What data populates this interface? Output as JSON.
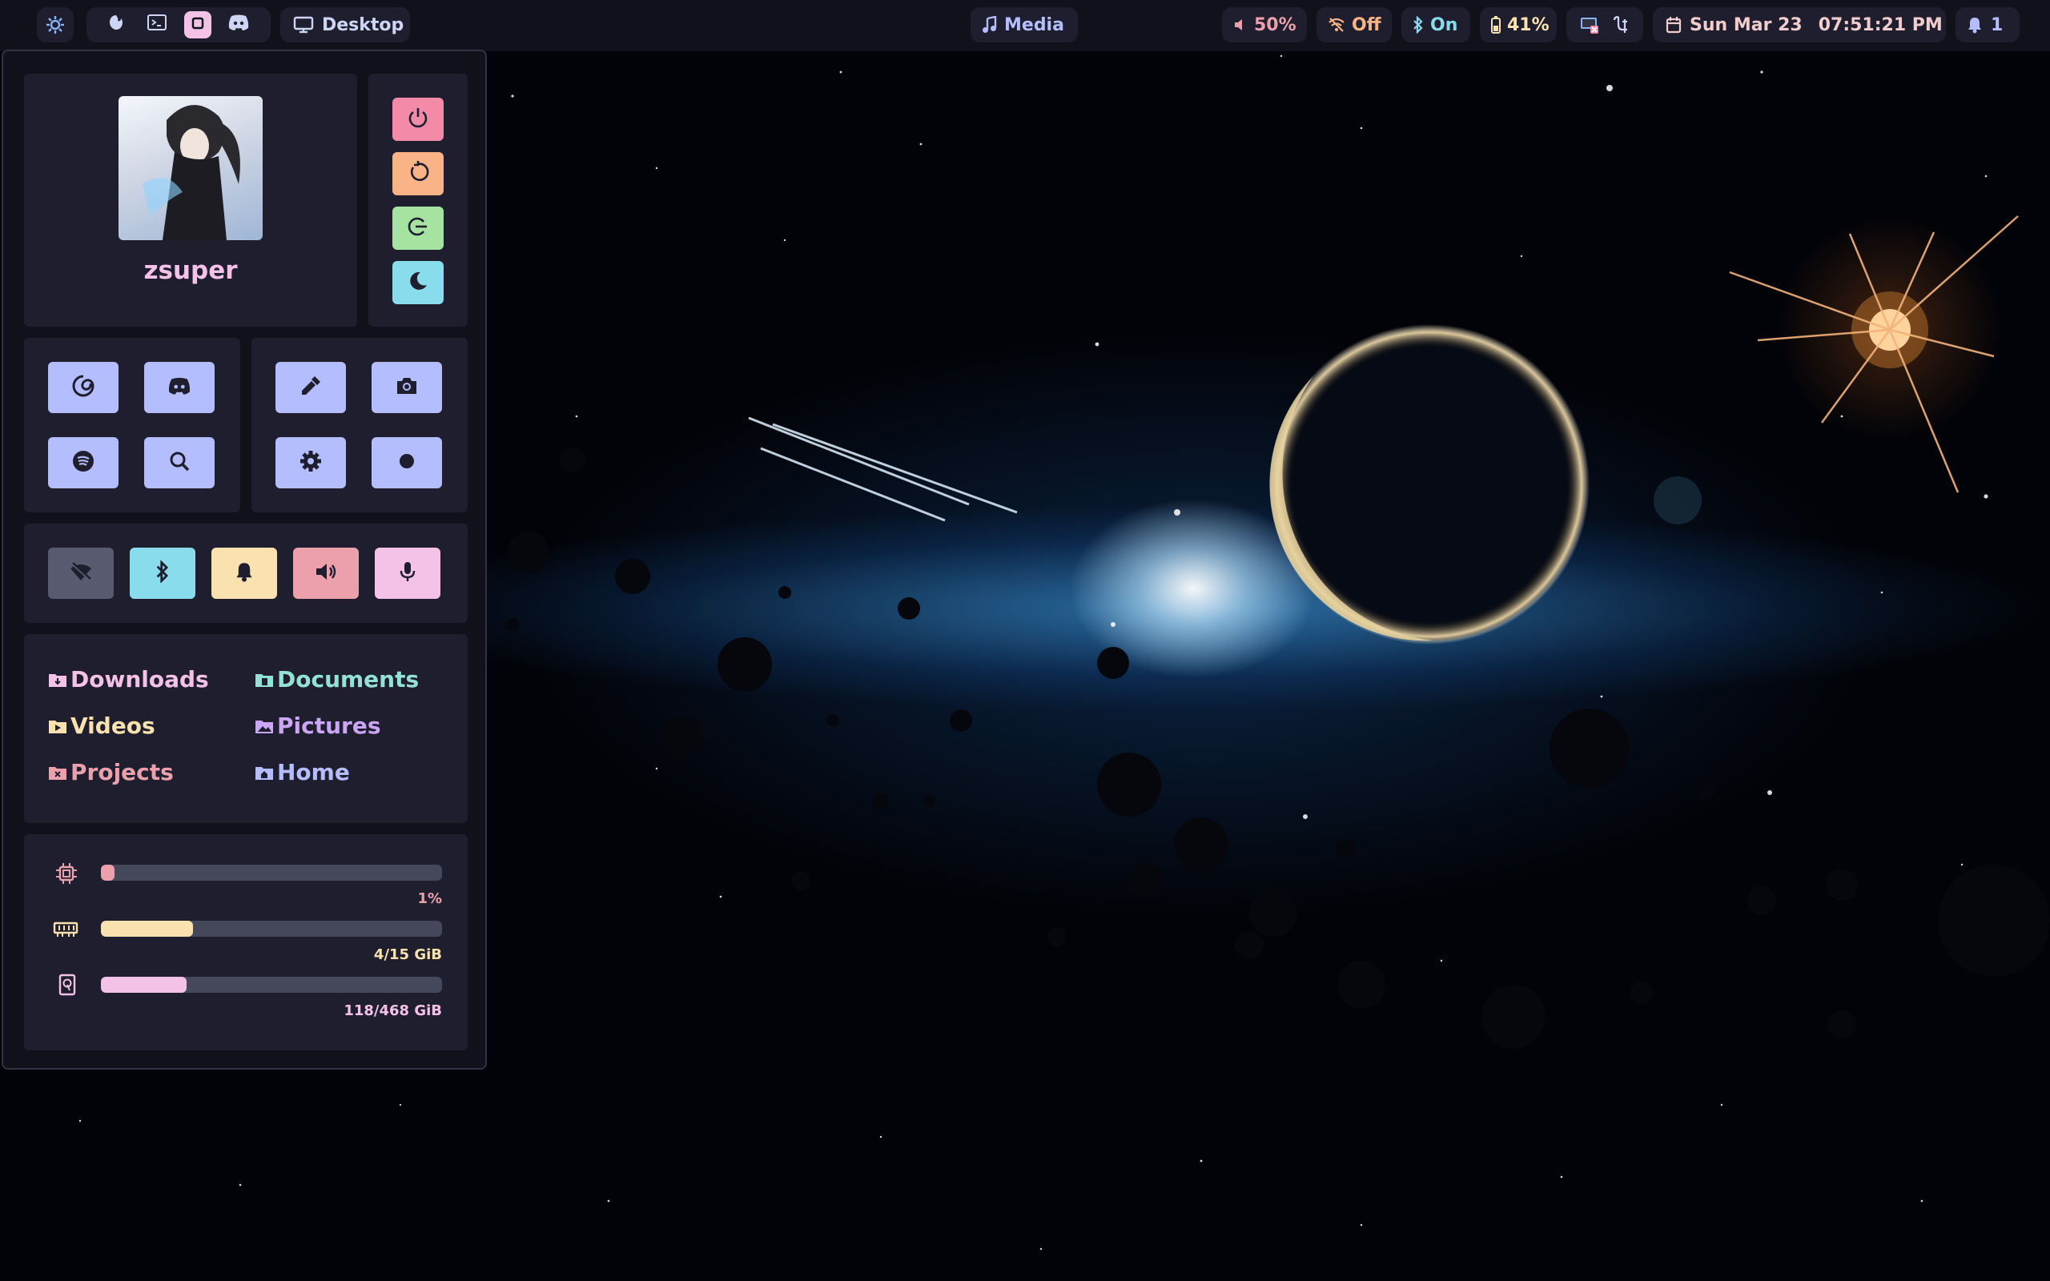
{
  "topbar": {
    "launcher_icon": "gear-icon",
    "workspaces": [
      {
        "icon": "firefox-icon",
        "active": false
      },
      {
        "icon": "terminal-icon",
        "active": false
      },
      {
        "icon": "square-icon",
        "active": true
      },
      {
        "icon": "discord-icon",
        "active": false
      }
    ],
    "desktop_label": "Desktop",
    "media_label": "Media",
    "volume": "50%",
    "wifi": "Off",
    "bluetooth": "On",
    "battery": "41%",
    "date": "Sun Mar 23",
    "time": "07:51:21 PM",
    "notifications": "1"
  },
  "profile": {
    "username": "zsuper"
  },
  "power": [
    "power-icon",
    "restart-icon",
    "logout-icon",
    "sleep-icon"
  ],
  "apps": [
    "browser-icon",
    "discord-icon",
    "spotify-icon",
    "search-icon"
  ],
  "tools": [
    "color-picker-icon",
    "screenshot-icon",
    "settings-icon",
    "record-icon"
  ],
  "toggles": [
    "wifi-off-icon",
    "bluetooth-icon",
    "bell-icon",
    "volume-icon",
    "microphone-icon"
  ],
  "folders": [
    {
      "label": "Downloads",
      "color": "#f5c2e7"
    },
    {
      "label": "Documents",
      "color": "#94e2d5"
    },
    {
      "label": "Videos",
      "color": "#f9e2af"
    },
    {
      "label": "Pictures",
      "color": "#cba6f7"
    },
    {
      "label": "Projects",
      "color": "#eba0ac"
    },
    {
      "label": "Home",
      "color": "#b4befe"
    }
  ],
  "resources": {
    "cpu": {
      "text": "1%",
      "fraction": 0.01,
      "color": "#eba0ac"
    },
    "ram": {
      "text": "4/15 GiB",
      "fraction": 0.27,
      "color": "#f9e2af"
    },
    "disk": {
      "text": "118/468 GiB",
      "fraction": 0.25,
      "color": "#f5c2e7"
    }
  },
  "colors": {
    "base": "#1e1e2e",
    "crust": "#11111b",
    "lavender": "#b4befe",
    "red": "#f38ba8",
    "peach": "#fab387",
    "green": "#a6e3a1",
    "teal": "#94e2d5",
    "yellow": "#f9e2af",
    "pink": "#f5c2e7",
    "surface": "#585b70"
  }
}
